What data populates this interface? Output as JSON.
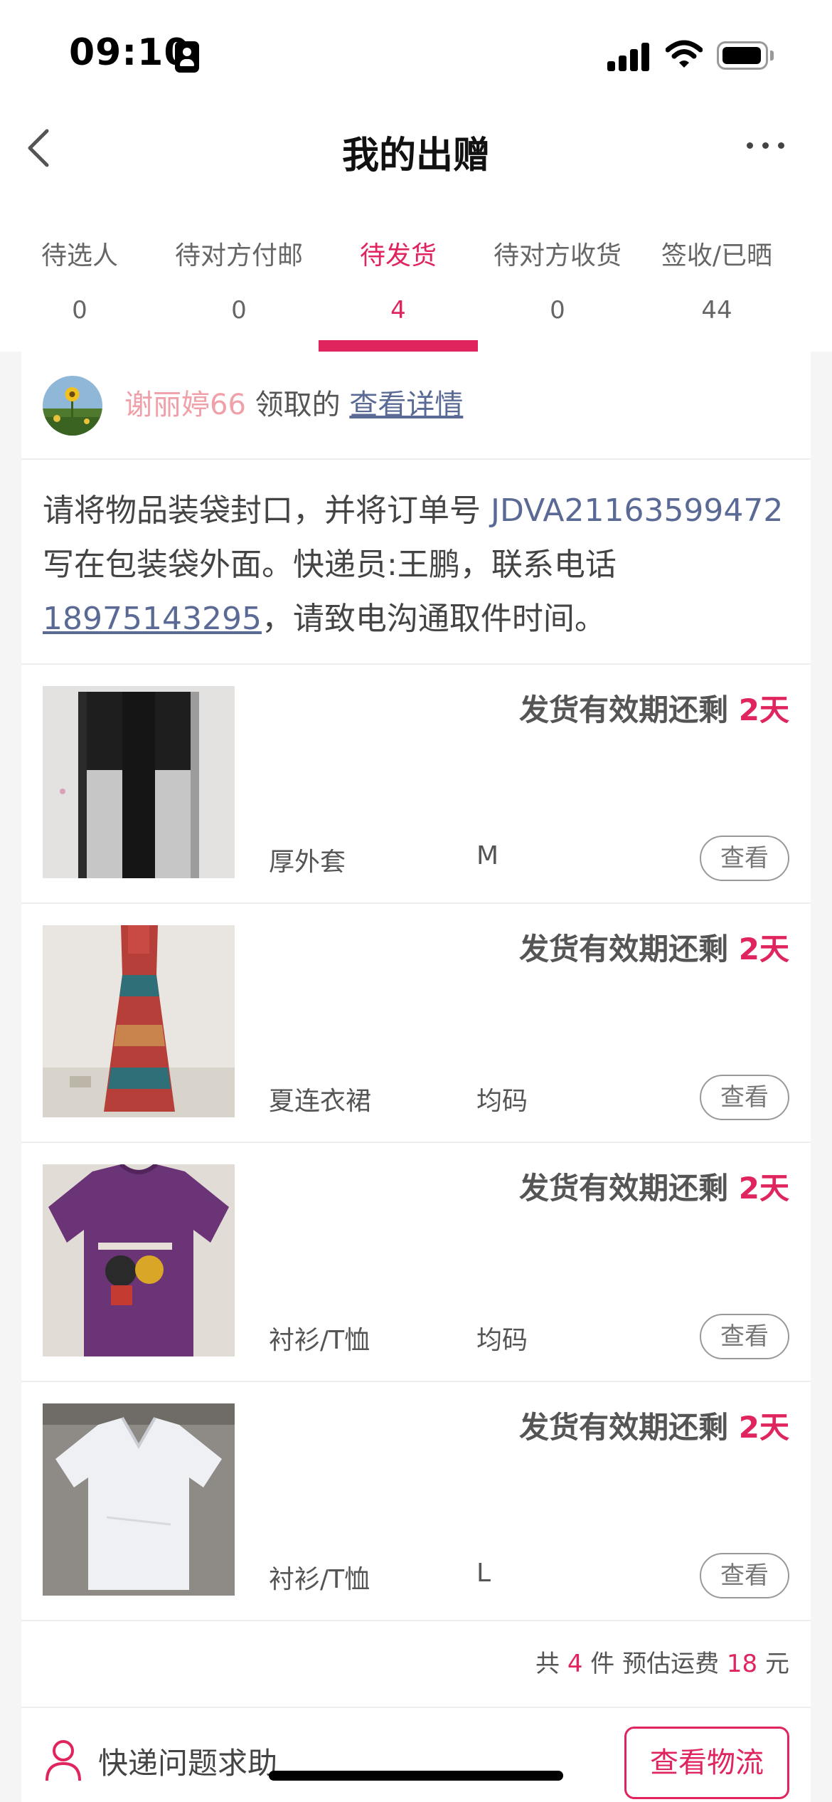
{
  "status_bar": {
    "time": "09:10"
  },
  "header": {
    "title": "我的出赠"
  },
  "tabs": [
    {
      "label": "待选人",
      "count": "0"
    },
    {
      "label": "待对方付邮",
      "count": "0"
    },
    {
      "label": "待发货",
      "count": "4",
      "active": true
    },
    {
      "label": "待对方收货",
      "count": "0"
    },
    {
      "label": "签收/已晒",
      "count": "44"
    }
  ],
  "receiver": {
    "name": "谢丽婷66",
    "suffix": "领取的",
    "detail_link": "查看详情"
  },
  "notice": {
    "part1": "请将物品装袋封口，并将订单号 ",
    "order_no": "JDVA21163599472",
    "part2": " 写在包装袋外面。快递员:王鹏，联系电话",
    "phone": "18975143295",
    "part3": "，请致电沟通取件时间。"
  },
  "items": [
    {
      "deadline_prefix": "发货有效期还剩 ",
      "deadline_days": "2天",
      "name": "厚外套",
      "size": "M",
      "view_label": "查看"
    },
    {
      "deadline_prefix": "发货有效期还剩 ",
      "deadline_days": "2天",
      "name": "夏连衣裙",
      "size": "均码",
      "view_label": "查看"
    },
    {
      "deadline_prefix": "发货有效期还剩 ",
      "deadline_days": "2天",
      "name": "衬衫/T恤",
      "size": "均码",
      "view_label": "查看"
    },
    {
      "deadline_prefix": "发货有效期还剩 ",
      "deadline_days": "2天",
      "name": "衬衫/T恤",
      "size": "L",
      "view_label": "查看"
    }
  ],
  "summary": {
    "prefix": "共 ",
    "count": "4",
    "middle": " 件 预估运费 ",
    "fee": "18",
    "suffix": " 元"
  },
  "footer": {
    "help_label": "快递问题求助",
    "logistics_button": "查看物流"
  },
  "colors": {
    "accent": "#e0245e",
    "link": "#5a6a95",
    "name_pink": "#f0a0a8"
  }
}
